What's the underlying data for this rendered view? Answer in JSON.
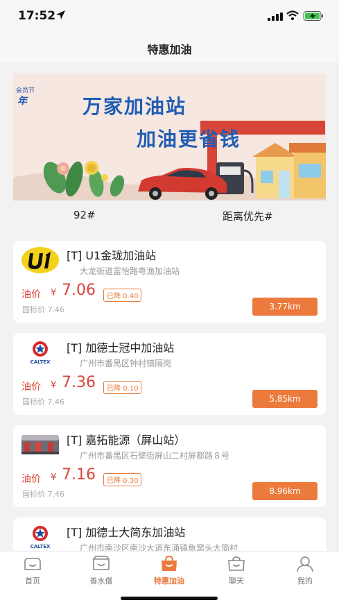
{
  "status_bar": {
    "time": "17:52"
  },
  "nav": {
    "title": "特惠加油"
  },
  "banner": {
    "tag": "会员节",
    "logo": "年",
    "line1": "万家加油站",
    "line2": "加油更省钱"
  },
  "filters": {
    "fuel": "92#",
    "sort": "距离优先#"
  },
  "colors": {
    "accent": "#ec7a3c",
    "price_red": "#d9453b",
    "banner_blue": "#1f5db5"
  },
  "stations": [
    {
      "logo": "u1-logo",
      "name": "[T] U1金珑加油站",
      "address": "大龙街道富怡路粤渔加油站",
      "price_label": "油价",
      "currency": "¥",
      "price": "7.06",
      "drop": "已降 0.40",
      "national_price": "国标价 7.46",
      "distance": "3.77km"
    },
    {
      "logo": "caltex-logo",
      "name": "[T] 加德士冠中加油站",
      "address": "广州市番禺区钟村镇隔岗",
      "price_label": "油价",
      "currency": "¥",
      "price": "7.36",
      "drop": "已降 0.10",
      "national_price": "国标价 7.46",
      "distance": "5.85km"
    },
    {
      "logo": "station-photo",
      "name": "[T] 嘉拓能源（屏山站）",
      "address": "广州市番禺区石壁街屏山二村屏都路８号",
      "price_label": "油价",
      "currency": "¥",
      "price": "7.16",
      "drop": "已降 0.30",
      "national_price": "国标价 7.46",
      "distance": "8.96km"
    },
    {
      "logo": "caltex-logo",
      "name": "[T] 加德士大简东加油站",
      "address": "广州市南沙区南沙大道东涌镇鱼窝头大简村"
    }
  ],
  "caltex_text": "CALTEX",
  "tabs": [
    {
      "label": "首页",
      "icon": "home-icon"
    },
    {
      "label": "善水僧",
      "icon": "shop-icon"
    },
    {
      "label": "特惠加油",
      "icon": "fuel-bag-icon",
      "active": true
    },
    {
      "label": "聊天",
      "icon": "chat-icon"
    },
    {
      "label": "我的",
      "icon": "profile-icon"
    }
  ]
}
